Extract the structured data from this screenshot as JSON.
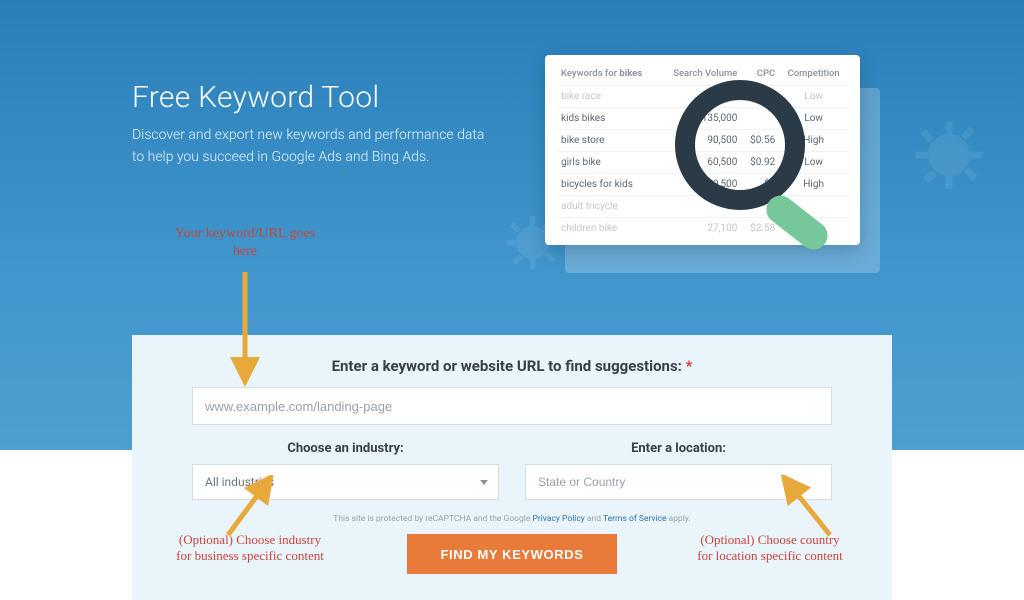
{
  "hero": {
    "title": "Free Keyword Tool",
    "subtitle": "Discover and export new keywords and performance data to help you succeed in Google Ads and Bing Ads."
  },
  "preview": {
    "header_prefix": "Keywords for ",
    "header_term": "bikes",
    "col_volume": "Search Volume",
    "col_cpc": "CPC",
    "col_comp": "Competition",
    "rows": [
      {
        "kw": "bike race",
        "vol": "",
        "cpc": "",
        "comp": "Low",
        "faded": true
      },
      {
        "kw": "kids bikes",
        "vol": "135,000",
        "cpc": "",
        "comp": "Low"
      },
      {
        "kw": "bike store",
        "vol": "90,500",
        "cpc": "$0.56",
        "comp": "High"
      },
      {
        "kw": "girls bike",
        "vol": "60,500",
        "cpc": "$0.92",
        "comp": "Low"
      },
      {
        "kw": "bicycles for kids",
        "vol": "49,500",
        "cpc": "$1",
        "comp": "High"
      },
      {
        "kw": "adult tricycle",
        "vol": "",
        "cpc": "",
        "comp": "",
        "faded": true
      },
      {
        "kw": "children bike",
        "vol": "27,100",
        "cpc": "$2.58",
        "comp": "",
        "faded": true
      }
    ]
  },
  "form": {
    "title": "Enter a keyword or website URL to find suggestions: ",
    "required_mark": "*",
    "url_placeholder": "www.example.com/landing-page",
    "industry_label": "Choose an industry:",
    "industry_selected": "All industries",
    "location_label": "Enter a location:",
    "location_placeholder": "State or Country",
    "legal_pre": "This site is protected by reCAPTCHA and the Google ",
    "legal_privacy": "Privacy Policy",
    "legal_and": " and ",
    "legal_tos": "Terms of Service",
    "legal_post": " apply.",
    "cta": "FIND MY KEYWORDS"
  },
  "annotations": {
    "top": "Your keyword/URL goes\nhere",
    "industry": "(Optional) Choose industry\nfor business specific content",
    "location": "(Optional) Choose country\nfor location specific content"
  }
}
